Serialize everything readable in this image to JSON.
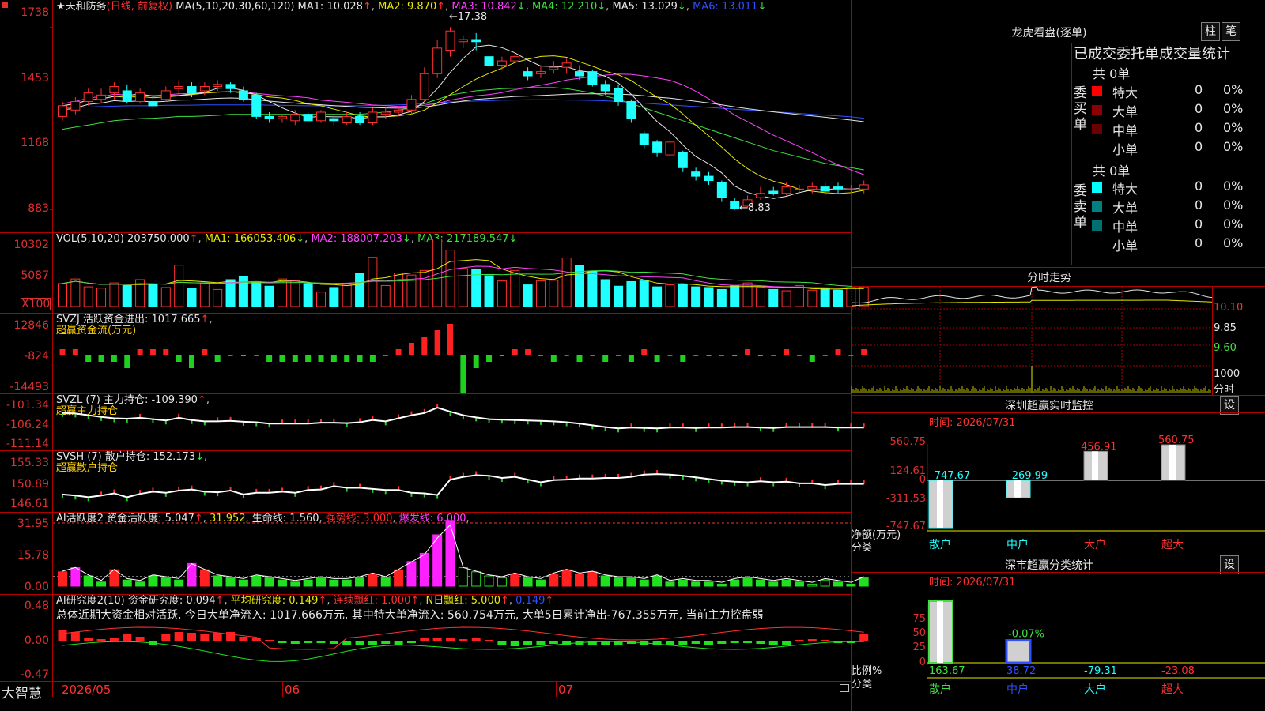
{
  "stock": {
    "star": "★",
    "name": "天和防务",
    "mode": "(日线, 前复权)",
    "ma_header_label": "MA(5,10,20,30,60,120)",
    "ma1": "MA1: 10.028",
    "ma2": "MA2: 9.870",
    "ma3": "MA3: 10.842",
    "ma4": "MA4: 12.210",
    "ma5": "MA5: 13.029",
    "ma6": "MA6: 13.011",
    "price_axis": [
      "1738",
      "1453",
      "1168",
      "883"
    ],
    "high_label": "17.38",
    "low_label": "8.83"
  },
  "vol": {
    "label": "VOL(5,10,20)",
    "value": "203750.000",
    "ma1": "MA1: 166053.406",
    "ma2": "MA2: 188007.203",
    "ma3": "MA3: 217189.547",
    "axis": [
      "10302",
      "5087",
      "X100"
    ]
  },
  "svzj": {
    "label": "SVZJ  活跃资金进出: 1017.665",
    "sub": "超赢资金流(万元)",
    "axis": [
      "12846",
      "-824",
      "-14493"
    ]
  },
  "svzl": {
    "label": "SVZL (7) 主力持仓: -109.390",
    "sub": "超赢主力持仓",
    "axis": [
      "-101.34",
      "-106.24",
      "-111.14"
    ]
  },
  "svsh": {
    "label": "SVSH (7) 散户持仓: 152.173",
    "sub": "超赢散户持仓",
    "axis": [
      "155.33",
      "150.89",
      "146.61"
    ]
  },
  "ai1": {
    "label1": "AI活跃度2 资金活跃度: 5.047",
    "val2": "31.952",
    "val3": "生命线: 1.560",
    "val4": "强势线: 3.000",
    "val5": "爆发线: 6.000",
    "axis": [
      "31.95",
      "15.78",
      "0.00"
    ]
  },
  "ai2": {
    "label1": "AI研究度2(10) 资金研究度: 0.094",
    "val2": "平均研究度: 0.149",
    "val3": "连续飘红: 1.000",
    "val4": "N日飘红: 5.000",
    "val5": "0.149",
    "summary": "总体近期大资金相对活跃, 今日大单净流入: 1017.666万元, 其中特大单净流入: 560.754万元, 大单5日累计净出-767.355万元, 当前主力控盘弱",
    "axis": [
      "0.48",
      "0.00",
      "-0.47"
    ]
  },
  "footer": {
    "brand": "大智慧",
    "d1": "2026/05",
    "d2": "06",
    "d3": "07"
  },
  "right": {
    "lhb_title": "龙虎看盘(逐单)",
    "btn_zhu": "柱",
    "btn_bi": "笔",
    "order_title": "已成交委托单成交量统计",
    "buy_side": "委买单",
    "sell_side": "委卖单",
    "buy_total": "共 0单",
    "sell_total": "共 0单",
    "rows": [
      {
        "label": "特大",
        "n": "0",
        "p": "0%"
      },
      {
        "label": "大单",
        "n": "0",
        "p": "0%"
      },
      {
        "label": "中单",
        "n": "0",
        "p": "0%"
      },
      {
        "label": "小单",
        "n": "0",
        "p": "0%"
      }
    ],
    "fenshi_title": "分时走势",
    "fenshi_axis": [
      "10.10",
      "9.85",
      "9.60",
      "1000",
      "分时"
    ],
    "sz_monitor_title": "深圳超赢实时监控",
    "sz_monitor_btn": "设",
    "monitor_time": "时间: 2026/07/31",
    "monitor_axis": [
      "560.75",
      "124.61",
      "0",
      "-311.53",
      "-747.67"
    ],
    "monitor_ylabel": "净额(万元)",
    "monitor_xlabel": "分类",
    "monitor_cats": [
      "散户",
      "中户",
      "大户",
      "超大"
    ],
    "monitor_vals": [
      "-747.67",
      "-269.99",
      "456.91",
      "560.75"
    ],
    "sz_class_title": "深市超赢分类统计",
    "sz_class_btn": "设",
    "class_time": "时间: 2026/07/31",
    "class_axis": [
      "75",
      "50",
      "25",
      "0"
    ],
    "class_ylabel": "比例%",
    "class_xlabel": "分类",
    "class_cats": [
      "散户",
      "中户",
      "大户",
      "超大"
    ],
    "class_vals": [
      "163.67",
      "38.72",
      "-79.31",
      "-23.08"
    ],
    "class_mid_label": "-0.07%"
  },
  "colors": {
    "up": "#ff3030",
    "down": "#20ffff",
    "grid": "#b00000"
  },
  "chart_data": {
    "type": "candlestick",
    "candles": [
      [
        13.2,
        13.7,
        13.0,
        13.9
      ],
      [
        13.5,
        13.9,
        13.3,
        14.1
      ],
      [
        13.9,
        14.3,
        13.7,
        14.5
      ],
      [
        14.0,
        14.2,
        13.8,
        14.5
      ],
      [
        14.3,
        14.6,
        14.0,
        14.8
      ],
      [
        14.4,
        13.9,
        13.8,
        14.7
      ],
      [
        13.9,
        14.3,
        13.8,
        14.5
      ],
      [
        13.9,
        13.7,
        13.5,
        14.1
      ],
      [
        14.0,
        14.4,
        13.9,
        14.6
      ],
      [
        14.5,
        14.6,
        14.2,
        14.9
      ],
      [
        14.6,
        14.3,
        14.1,
        14.8
      ],
      [
        14.4,
        14.6,
        14.2,
        14.8
      ],
      [
        14.6,
        14.7,
        14.4,
        14.9
      ],
      [
        14.7,
        14.5,
        14.3,
        14.8
      ],
      [
        14.4,
        14.0,
        13.9,
        14.6
      ],
      [
        14.2,
        13.2,
        13.1,
        14.3
      ],
      [
        13.2,
        13.1,
        12.9,
        13.4
      ],
      [
        13.1,
        13.2,
        12.9,
        13.3
      ],
      [
        13.0,
        13.3,
        12.8,
        13.5
      ],
      [
        13.3,
        13.0,
        12.9,
        13.4
      ],
      [
        13.0,
        13.4,
        12.9,
        13.5
      ],
      [
        13.1,
        13.0,
        12.8,
        13.3
      ],
      [
        12.9,
        13.2,
        12.8,
        13.4
      ],
      [
        13.2,
        12.9,
        12.8,
        13.4
      ],
      [
        12.9,
        13.4,
        12.8,
        13.6
      ],
      [
        13.3,
        13.4,
        13.1,
        13.6
      ],
      [
        13.4,
        13.5,
        13.2,
        13.7
      ],
      [
        13.5,
        14.0,
        13.3,
        14.2
      ],
      [
        14.0,
        15.2,
        13.9,
        15.5
      ],
      [
        15.2,
        16.4,
        15.0,
        16.8
      ],
      [
        16.3,
        17.2,
        16.0,
        17.38
      ],
      [
        16.7,
        16.8,
        16.4,
        17.0
      ],
      [
        16.8,
        16.7,
        16.3,
        17.1
      ],
      [
        16.0,
        15.6,
        15.4,
        16.2
      ],
      [
        15.6,
        15.8,
        15.4,
        16.0
      ],
      [
        15.8,
        16.0,
        15.7,
        16.2
      ],
      [
        15.3,
        15.1,
        14.9,
        15.5
      ],
      [
        15.2,
        15.3,
        15.0,
        15.6
      ],
      [
        15.4,
        15.5,
        15.2,
        15.8
      ],
      [
        15.5,
        15.7,
        15.2,
        15.9
      ],
      [
        15.3,
        15.1,
        14.9,
        15.6
      ],
      [
        15.3,
        14.7,
        14.6,
        15.4
      ],
      [
        14.7,
        14.4,
        14.2,
        14.9
      ],
      [
        14.5,
        13.9,
        13.7,
        14.7
      ],
      [
        13.9,
        13.1,
        12.9,
        14.0
      ],
      [
        12.4,
        11.9,
        11.7,
        12.5
      ],
      [
        12.0,
        11.5,
        11.3,
        12.1
      ],
      [
        11.4,
        12.0,
        11.2,
        12.4
      ],
      [
        11.5,
        10.8,
        10.6,
        11.6
      ],
      [
        10.6,
        10.4,
        10.2,
        10.8
      ],
      [
        10.4,
        10.2,
        10.0,
        10.6
      ],
      [
        10.1,
        9.4,
        9.2,
        10.2
      ],
      [
        9.2,
        8.9,
        8.83,
        9.4
      ],
      [
        9.0,
        9.3,
        8.9,
        9.5
      ],
      [
        9.4,
        9.6,
        9.3,
        9.9
      ],
      [
        9.7,
        9.6,
        9.5,
        9.9
      ],
      [
        9.6,
        9.9,
        9.5,
        10.1
      ],
      [
        9.8,
        9.8,
        9.6,
        10.0
      ],
      [
        9.8,
        9.9,
        9.6,
        10.1
      ],
      [
        9.9,
        9.7,
        9.5,
        10.1
      ],
      [
        9.9,
        9.8,
        9.6,
        10.1
      ],
      [
        9.8,
        9.8,
        9.6,
        10.0
      ],
      [
        9.8,
        10.0,
        9.6,
        10.2
      ]
    ],
    "volume": [
      3.5,
      4.2,
      3.0,
      2.8,
      3.6,
      3.2,
      4.1,
      3.4,
      2.9,
      6.3,
      2.8,
      3.5,
      2.6,
      4.1,
      4.6,
      3.8,
      3.1,
      4.2,
      3.9,
      3.5,
      2.2,
      2.9,
      3.4,
      5.0,
      7.5,
      3.2,
      5.1,
      4.8,
      5.5,
      10.3,
      8.6,
      5.8,
      5.6,
      4.7,
      3.9,
      5.5,
      3.3,
      3.9,
      4.0,
      7.4,
      6.3,
      5.4,
      4.1,
      3.1,
      3.8,
      3.9,
      3.0,
      3.3,
      3.4,
      3.0,
      2.9,
      2.6,
      3.2,
      3.6,
      2.9,
      2.6,
      2.4,
      3.2,
      2.5,
      2.7,
      2.5,
      2.9,
      3.0
    ],
    "svzj": [
      1,
      1,
      -1,
      -1,
      -1,
      -2,
      1,
      1,
      1,
      -1,
      -2,
      1,
      -1,
      0,
      0,
      0,
      -1,
      -1,
      -1,
      -1,
      -1,
      -1,
      -1,
      -1,
      -1,
      0,
      1,
      2,
      3,
      4,
      5,
      -6,
      -2,
      -1,
      0,
      1,
      1,
      0,
      -1,
      0,
      -1,
      0,
      -1,
      0,
      -1,
      1,
      -1,
      0,
      -1,
      0,
      0,
      0,
      0,
      1,
      0,
      0,
      1,
      0,
      -1,
      0,
      1,
      0,
      1
    ],
    "svzl": [
      -104.2,
      -104.3,
      -104.7,
      -105.1,
      -105.4,
      -105.5,
      -105.3,
      -105.6,
      -105.9,
      -105.3,
      -105.8,
      -106.1,
      -106.1,
      -106.0,
      -106.2,
      -106.3,
      -106.6,
      -106.6,
      -106.6,
      -106.6,
      -106.4,
      -106.4,
      -106.5,
      -106.3,
      -105.8,
      -106.1,
      -105.4,
      -104.7,
      -104.2,
      -103.0,
      -103.9,
      -104.7,
      -105.2,
      -105.6,
      -105.7,
      -105.8,
      -105.9,
      -106.0,
      -106.1,
      -106.3,
      -106.6,
      -107.0,
      -107.4,
      -107.7,
      -107.5,
      -107.6,
      -107.7,
      -107.5,
      -107.5,
      -107.6,
      -107.5,
      -107.5,
      -107.4,
      -107.4,
      -107.5,
      -107.6,
      -107.4,
      -107.4,
      -107.4,
      -107.4,
      -107.5,
      -107.5,
      -107.5
    ],
    "svsh": [
      148.6,
      148.4,
      148.1,
      148.4,
      148.8,
      148.1,
      148.7,
      149.1,
      148.9,
      149.3,
      149.5,
      149.1,
      149.0,
      149.3,
      148.6,
      148.9,
      148.9,
      149.1,
      148.9,
      149.4,
      149.5,
      150.1,
      149.8,
      149.8,
      149.6,
      149.4,
      149.4,
      148.9,
      148.8,
      148.5,
      151.3,
      151.8,
      152.1,
      152.0,
      151.6,
      151.8,
      151.3,
      150.8,
      151.2,
      151.3,
      151.5,
      151.5,
      151.6,
      151.6,
      151.8,
      152.2,
      152.3,
      152.2,
      152.0,
      151.7,
      151.4,
      151.1,
      150.9,
      150.8,
      151.0,
      150.8,
      150.9,
      150.6,
      150.6,
      150.3,
      150.5,
      150.5,
      150.5
    ],
    "ai1": [
      7,
      9,
      5,
      2,
      8,
      3,
      2,
      5,
      4,
      3,
      11,
      8,
      5,
      4,
      3,
      5,
      4,
      3,
      2,
      3,
      4,
      3,
      3,
      4,
      6,
      4,
      8,
      12,
      16,
      25,
      32,
      9,
      7,
      5,
      4,
      6,
      4,
      3,
      6,
      8,
      6,
      7,
      5,
      4,
      4,
      3,
      5,
      2,
      3,
      2,
      2,
      1,
      3,
      4,
      3,
      2,
      3,
      2,
      1,
      3,
      2,
      1,
      4
    ],
    "ai2": [
      0.14,
      0.12,
      0.05,
      0.03,
      0.04,
      0.09,
      0.06,
      -0.04,
      0.1,
      0.12,
      0.11,
      0.1,
      0.11,
      0.12,
      0.06,
      0.04,
      0.02,
      -0.02,
      -0.03,
      -0.02,
      -0.02,
      -0.03,
      -0.04,
      -0.04,
      -0.04,
      -0.03,
      -0.04,
      -0.02,
      0.04,
      0.05,
      0.05,
      0.03,
      0.04,
      0.02,
      -0.04,
      -0.06,
      -0.04,
      -0.04,
      -0.03,
      -0.04,
      -0.04,
      -0.05,
      -0.04,
      -0.05,
      -0.03,
      -0.04,
      -0.04,
      -0.05,
      -0.05,
      -0.03,
      -0.04,
      -0.03,
      -0.02,
      -0.02,
      -0.03,
      -0.04,
      -0.04,
      0.02,
      0.03,
      0.02,
      -0.01,
      -0.02,
      0.09
    ]
  }
}
